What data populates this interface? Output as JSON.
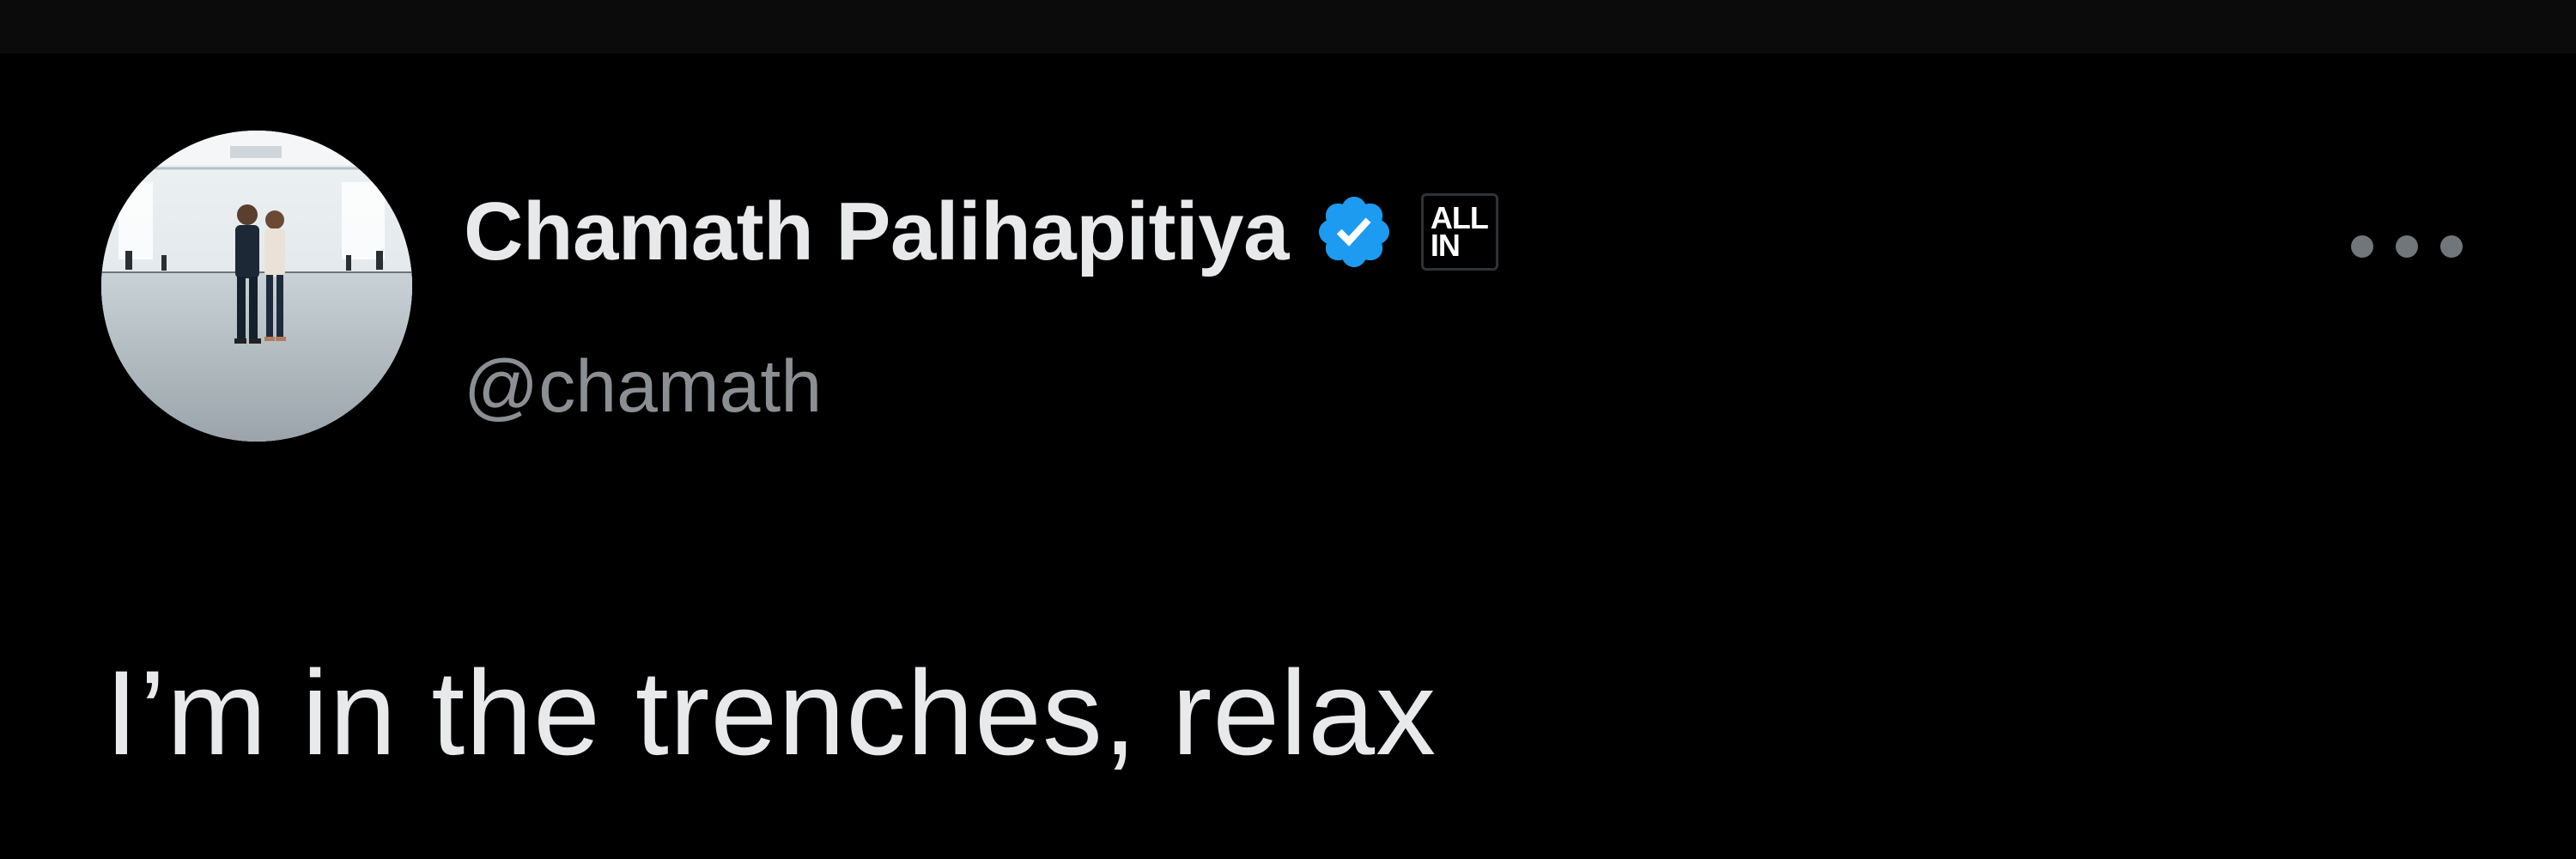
{
  "tweet": {
    "author": {
      "display_name": "Chamath Palihapitiya",
      "handle": "@chamath",
      "verified": true,
      "verified_color": "#1d9bf0",
      "affiliate_badge": {
        "line1": "ALL",
        "line2": "IN"
      }
    },
    "text": "I’m in the trenches, relax",
    "more_icon": "more-horizontal-icon"
  },
  "theme": {
    "background": "#000000",
    "text_primary": "#e7e9ea",
    "text_secondary": "#8b8f94"
  }
}
